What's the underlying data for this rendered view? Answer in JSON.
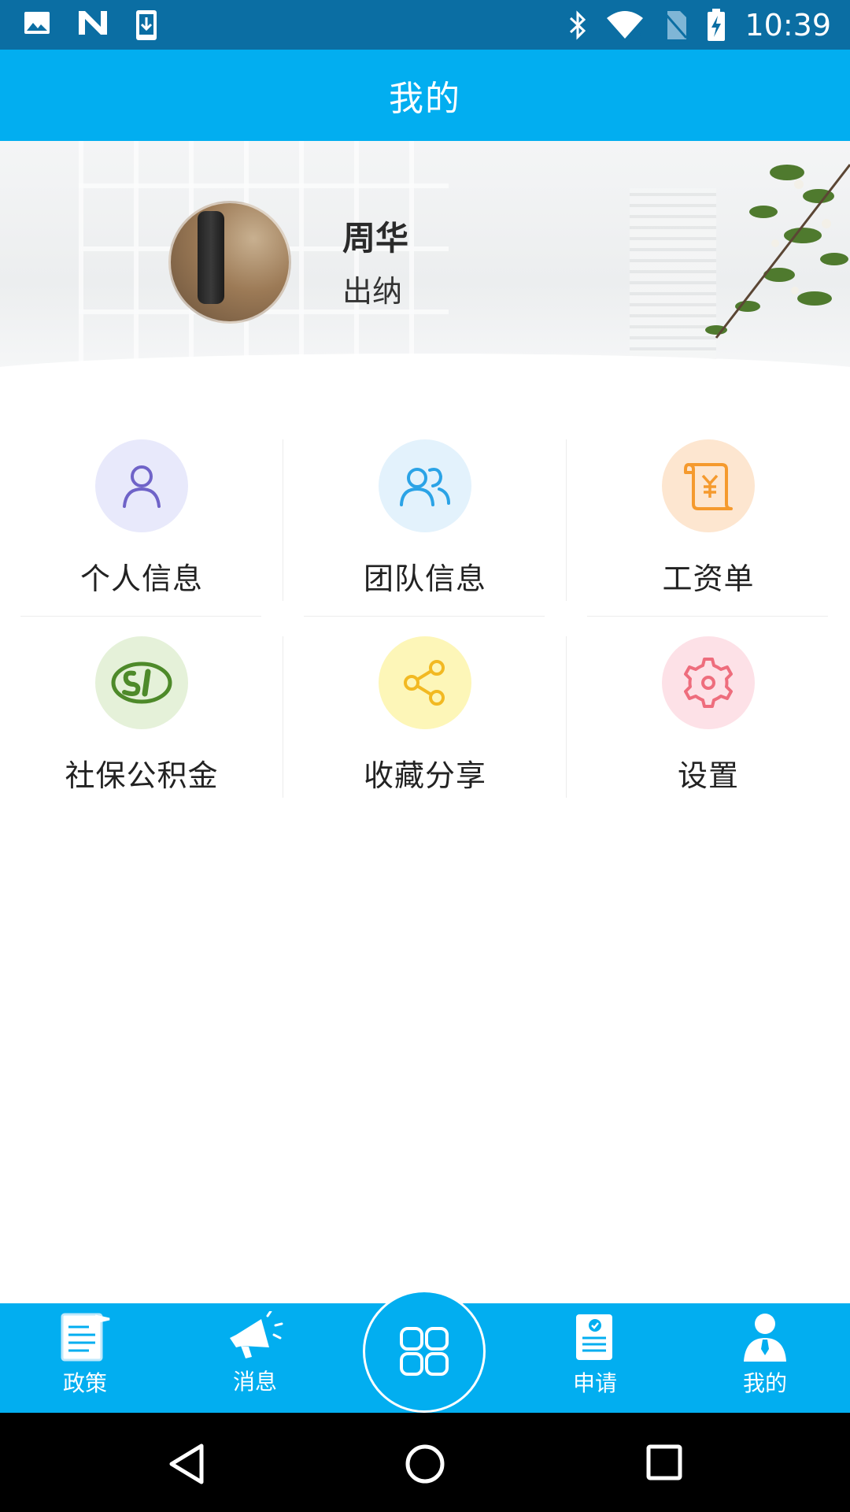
{
  "status_bar": {
    "time": "10:39",
    "left_icons": [
      "image-icon",
      "n-icon",
      "download-icon"
    ],
    "right_icons": [
      "bluetooth-icon",
      "wifi-icon",
      "no-sim-icon",
      "battery-charging-icon"
    ]
  },
  "app_bar": {
    "title": "我的"
  },
  "profile": {
    "name": "周华",
    "role": "出纳"
  },
  "menu": {
    "items": [
      {
        "label": "个人信息",
        "icon": "person-icon",
        "circle_color": "#e8e9fb",
        "icon_color": "#6f63c8"
      },
      {
        "label": "团队信息",
        "icon": "team-icon",
        "circle_color": "#e3f2fc",
        "icon_color": "#2ba3e6"
      },
      {
        "label": "工资单",
        "icon": "payslip-icon",
        "circle_color": "#fde6d0",
        "icon_color": "#f59a2e"
      },
      {
        "label": "社保公积金",
        "icon": "social-security-icon",
        "circle_color": "#e5f1d9",
        "icon_color": "#4e8a2a"
      },
      {
        "label": "收藏分享",
        "icon": "share-icon",
        "circle_color": "#fdf6b8",
        "icon_color": "#f2b922"
      },
      {
        "label": "设置",
        "icon": "gear-icon",
        "circle_color": "#fde1e7",
        "icon_color": "#ee6d7d"
      }
    ]
  },
  "bottom_nav": {
    "items": [
      {
        "label": "政策",
        "icon": "policy-icon"
      },
      {
        "label": "消息",
        "icon": "megaphone-icon"
      },
      {
        "label": "申请",
        "icon": "application-icon"
      },
      {
        "label": "我的",
        "icon": "user-icon"
      }
    ],
    "center_icon": "apps-grid-icon"
  },
  "system_nav": {
    "buttons": [
      "back-icon",
      "home-icon",
      "recents-icon"
    ]
  }
}
